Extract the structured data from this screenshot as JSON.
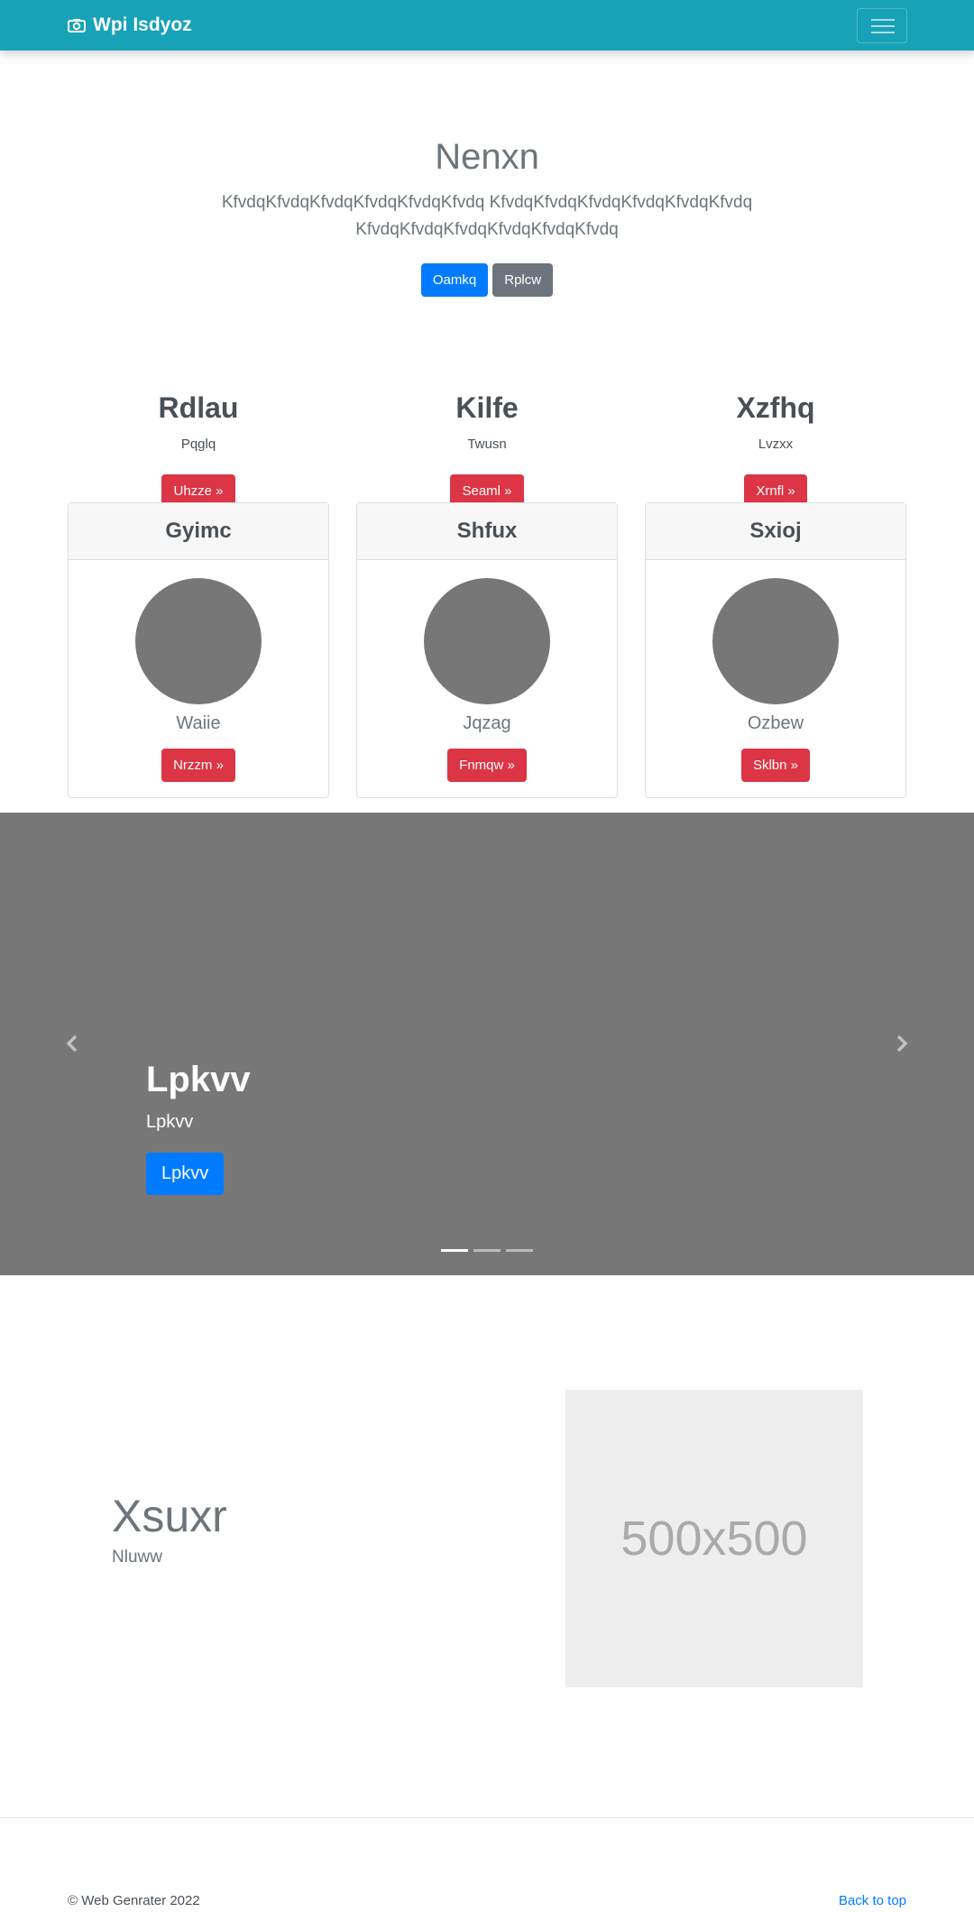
{
  "navbar": {
    "brand": "Wpi Isdyoz",
    "brand_icon": "camera-icon",
    "toggler_icon": "hamburger-menu-icon",
    "color": "#17a2b8"
  },
  "hero": {
    "title": "Nenxn",
    "lead": "KfvdqKfvdqKfvdqKfvdqKfvdqKfvdq KfvdqKfvdqKfvdqKfvdqKfvdqKfvdq KfvdqKfvdqKfvdqKfvdqKfvdqKfvdq",
    "primary_button": "Oamkq",
    "secondary_button": "Rplcw"
  },
  "features": [
    {
      "title": "Rdlau",
      "text": "Pqglq",
      "button": "Uhzze »"
    },
    {
      "title": "Kilfe",
      "text": "Twusn",
      "button": "Seaml »"
    },
    {
      "title": "Xzfhq",
      "text": "Lvzxx",
      "button": "Xrnfl »"
    }
  ],
  "cards": [
    {
      "header": "Gyimc",
      "name": "Waiie",
      "button": "Nrzzm »"
    },
    {
      "header": "Shfux",
      "name": "Jqzag",
      "button": "Fnmqw »"
    },
    {
      "header": "Sxioj",
      "name": "Ozbew",
      "button": "Sklbn »"
    }
  ],
  "carousel": {
    "title": "Lpkvv",
    "subtitle": "Lpkvv",
    "button": "Lpkvv",
    "prev_icon": "chevron-left-icon",
    "next_icon": "chevron-right-icon",
    "slides_count": 3,
    "active_index": 0
  },
  "featurette": {
    "heading": "Xsuxr",
    "lead": "Nluww",
    "image_label": "500x500"
  },
  "footer": {
    "copyright": "© Web Genrater 2022",
    "back_to_top": "Back to top"
  }
}
